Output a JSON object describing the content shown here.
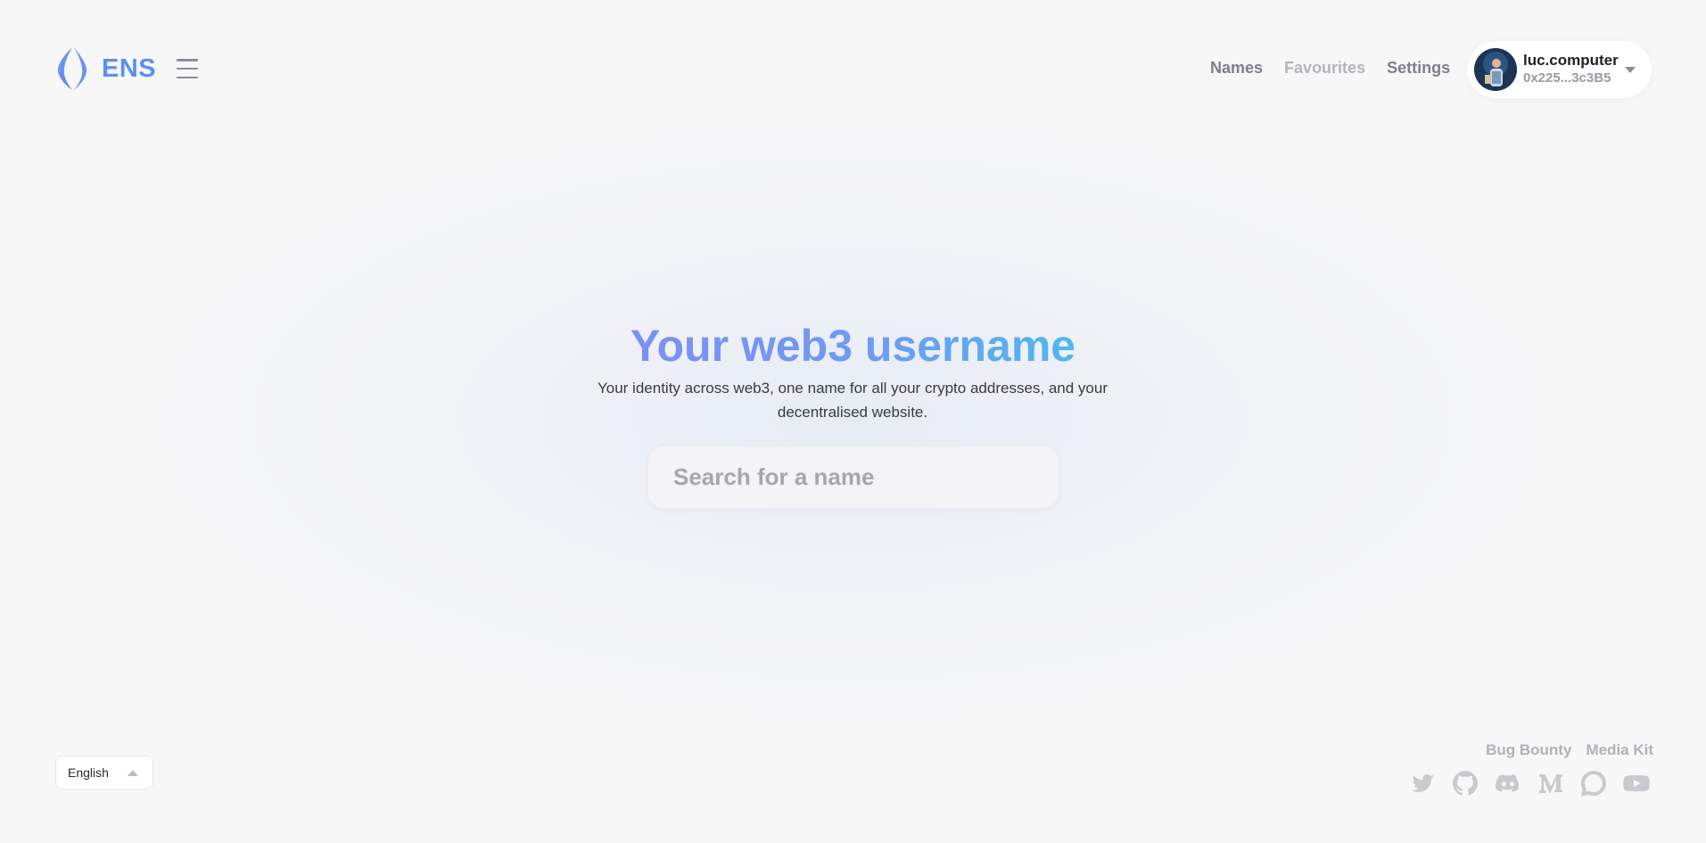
{
  "brand": {
    "name": "ENS",
    "color": "#5b8ff0"
  },
  "nav": {
    "names": "Names",
    "favourites": "Favourites",
    "settings": "Settings"
  },
  "account": {
    "name": "luc.computer",
    "address": "0x225...3c3B5"
  },
  "hero": {
    "title": "Your web3 username",
    "subtitle": "Your identity across web3, one name for all your crypto addresses, and your decentralised website."
  },
  "search": {
    "placeholder": "Search for a name",
    "value": ""
  },
  "footer": {
    "language": "English",
    "links": {
      "bug_bounty": "Bug Bounty",
      "media_kit": "Media Kit"
    },
    "socials": [
      "twitter-icon",
      "github-icon",
      "discord-icon",
      "medium-icon",
      "forum-icon",
      "youtube-icon"
    ]
  },
  "colors": {
    "gradient_start": "#7c8ff5",
    "gradient_end": "#4fb9ee",
    "muted": "#b0b2b8"
  }
}
